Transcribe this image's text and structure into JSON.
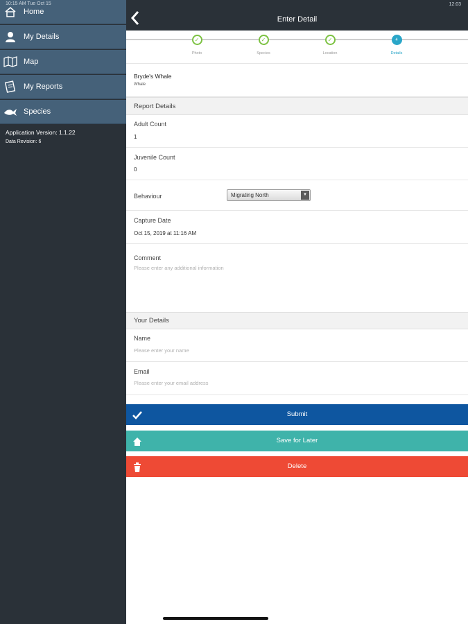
{
  "status_bar": {
    "left": "10:15 AM   Tue Oct 15",
    "right": "12:03"
  },
  "sidebar": {
    "items": [
      {
        "label": "Home",
        "icon": "home-icon"
      },
      {
        "label": "My Details",
        "icon": "person-icon"
      },
      {
        "label": "Map",
        "icon": "map-icon"
      },
      {
        "label": "My Reports",
        "icon": "reports-icon"
      },
      {
        "label": "Species",
        "icon": "species-icon"
      }
    ],
    "app_version": "Application Version: 1.1.22",
    "data_revision": "Data Revision: 6"
  },
  "header": {
    "title": "Enter Detail"
  },
  "stepper": {
    "steps": [
      {
        "label": "Photo",
        "state": "done"
      },
      {
        "label": "Species",
        "state": "done"
      },
      {
        "label": "Location",
        "state": "done"
      },
      {
        "label": "Details",
        "state": "active",
        "number": "4"
      }
    ]
  },
  "species": {
    "name": "Bryde's Whale",
    "type": "Whale"
  },
  "report_details": {
    "header": "Report Details",
    "adult_count_label": "Adult Count",
    "adult_count": "1",
    "juvenile_count_label": "Juvenile Count",
    "juvenile_count": "0",
    "behaviour_label": "Behaviour",
    "behaviour_value": "Migrating North",
    "capture_date_label": "Capture Date",
    "capture_date": "Oct 15, 2019 at 11:16 AM",
    "comment_label": "Comment",
    "comment_placeholder": "Please enter any additional information"
  },
  "your_details": {
    "header": "Your Details",
    "name_label": "Name",
    "name_placeholder": "Please enter your name",
    "email_label": "Email",
    "email_placeholder": "Please enter your email address"
  },
  "buttons": {
    "submit": "Submit",
    "save": "Save for Later",
    "delete": "Delete"
  },
  "colors": {
    "submit": "#0e56a0",
    "save": "#3fb3aa",
    "delete": "#ee4a35",
    "sidebar_item": "#456179",
    "dark": "#2a3138"
  }
}
